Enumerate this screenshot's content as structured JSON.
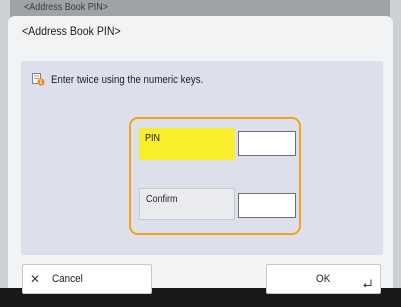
{
  "background_window": {
    "title": "<Address Book PIN>"
  },
  "dialog": {
    "title": "<Address Book PIN>",
    "instruction": "Enter twice using the numeric keys.",
    "instruction_icon": "info-icon",
    "fields": {
      "pin_label": "PIN",
      "pin_value": "",
      "confirm_label": "Confirm",
      "confirm_value": ""
    },
    "footer": {
      "cancel_label": "Cancel",
      "cancel_icon": "close-icon",
      "ok_label": "OK",
      "ok_icon": "enter-icon"
    }
  },
  "colors": {
    "highlight": "#f8ee2c",
    "group_border": "#f1a31c",
    "panel": "#dde0ea"
  }
}
